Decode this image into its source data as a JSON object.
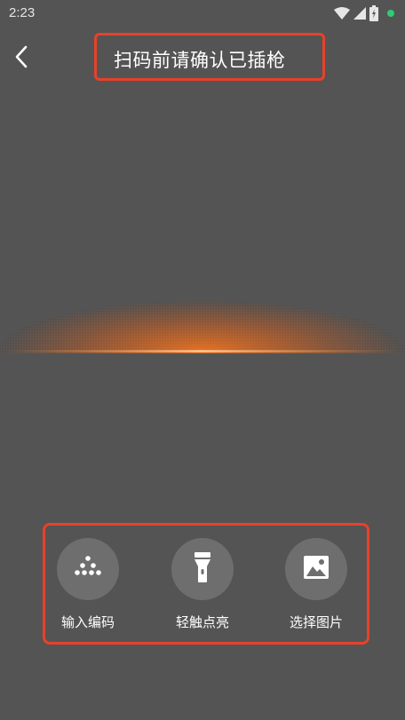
{
  "status_bar": {
    "time": "2:23",
    "icons": [
      "wifi-icon",
      "signal-icon",
      "battery-icon",
      "notification-dot"
    ],
    "dot_color": "#2ecc71"
  },
  "header": {
    "back_icon": "chevron-left-icon",
    "title": "扫码前请确认已插枪"
  },
  "colors": {
    "background": "#545454",
    "highlight_border": "#e8412a",
    "scan_line": "#ff7a1f",
    "action_circle": "#6e6e6e"
  },
  "actions": [
    {
      "icon": "keypad-icon",
      "label": "输入编码"
    },
    {
      "icon": "flashlight-icon",
      "label": "轻触点亮"
    },
    {
      "icon": "image-icon",
      "label": "选择图片"
    }
  ]
}
